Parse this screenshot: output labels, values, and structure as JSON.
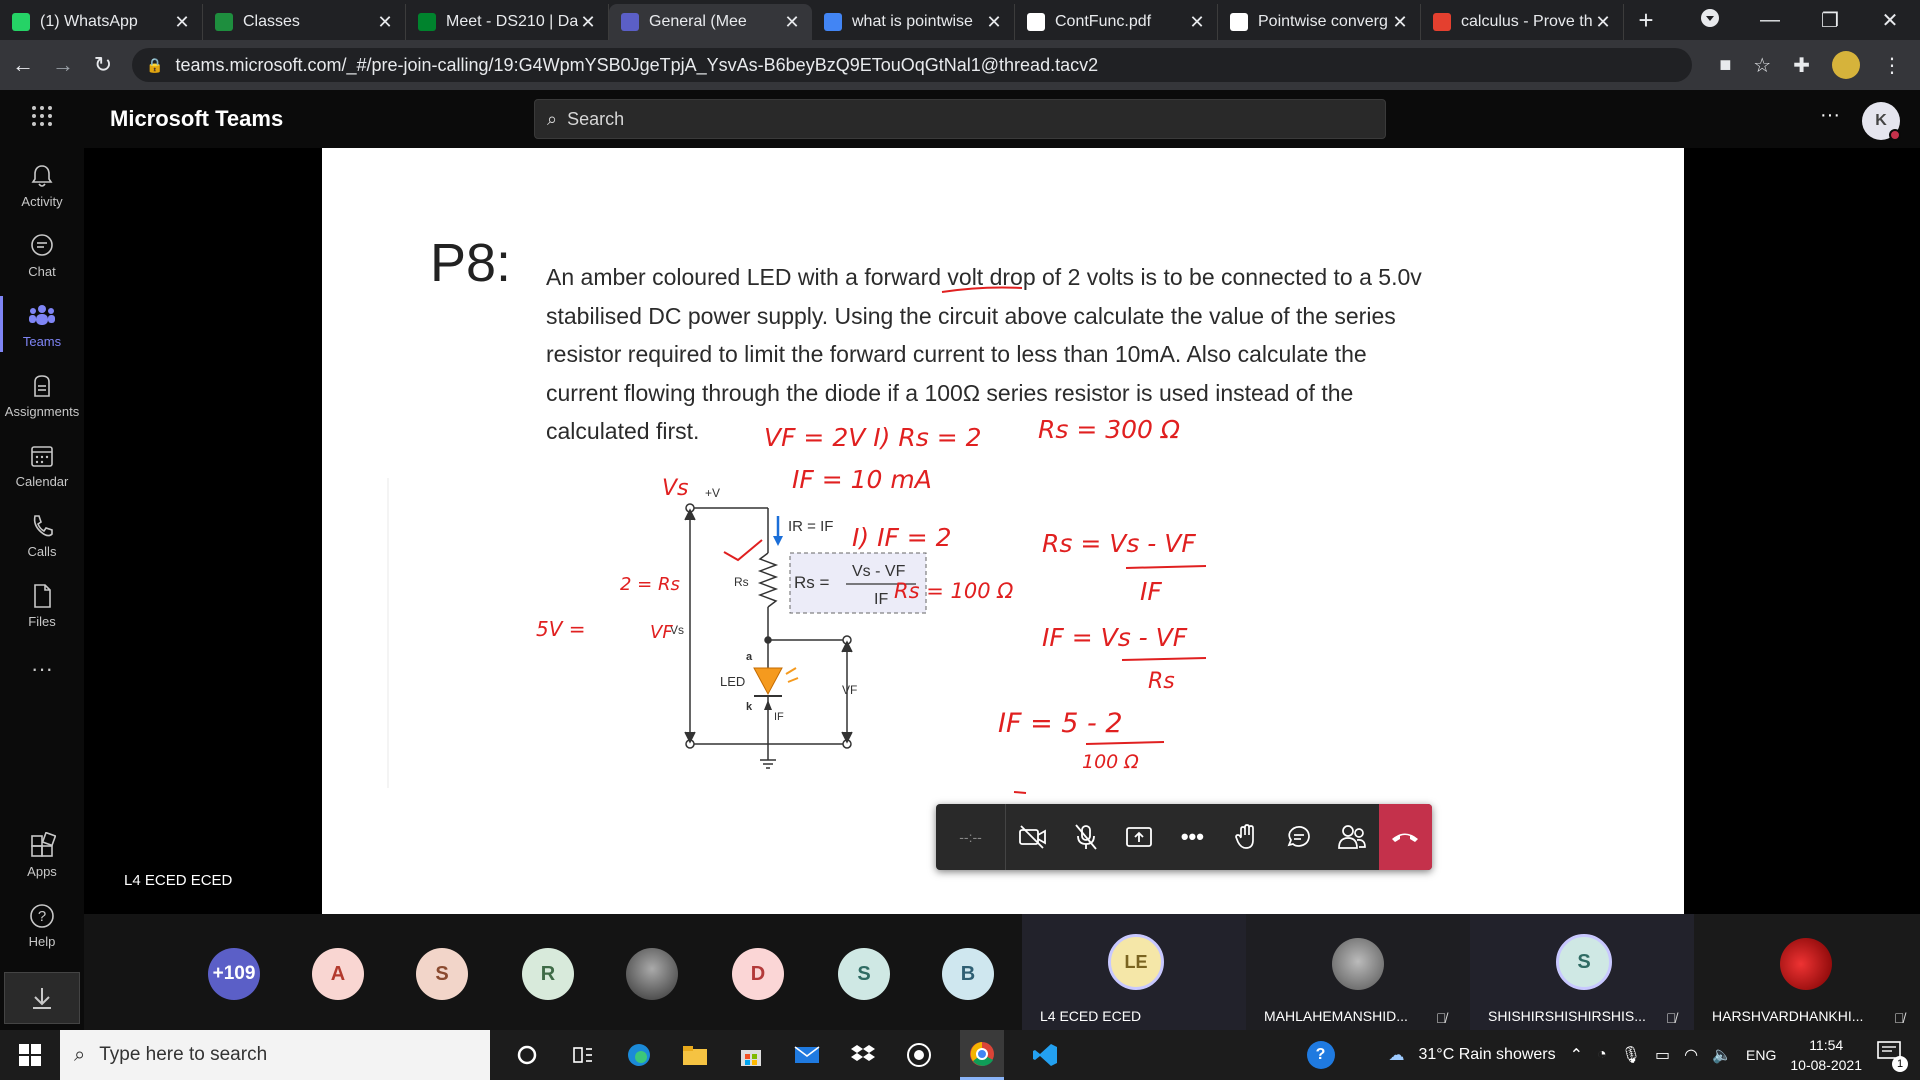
{
  "browser": {
    "tabs": [
      {
        "label": "(1) WhatsApp",
        "color": "#25d366"
      },
      {
        "label": "Classes",
        "color": "#1e8e3e"
      },
      {
        "label": "Meet - DS210 | Da",
        "color": "#00832d"
      },
      {
        "label": "General (Mee",
        "color": "#5b5fc7"
      },
      {
        "label": "what is pointwise",
        "color": "#4285f4"
      },
      {
        "label": "ContFunc.pdf",
        "color": "#ffffff"
      },
      {
        "label": "Pointwise converg",
        "color": "#ffffff"
      },
      {
        "label": "calculus - Prove th",
        "color": "#e4402f"
      }
    ],
    "url": "teams.microsoft.com/_#/pre-join-calling/19:G4WpmYSB0JgeTpjA_YsvAs-B6beyBzQ9ETouOqGtNal1@thread.tacv2"
  },
  "teams": {
    "app_title": "Microsoft Teams",
    "search_placeholder": "Search",
    "user_initial": "K",
    "rail": [
      {
        "label": "Activity",
        "icon": "bell-icon"
      },
      {
        "label": "Chat",
        "icon": "chat-icon"
      },
      {
        "label": "Teams",
        "icon": "teams-icon"
      },
      {
        "label": "Assignments",
        "icon": "assignments-icon"
      },
      {
        "label": "Calendar",
        "icon": "calendar-icon"
      },
      {
        "label": "Calls",
        "icon": "phone-icon"
      },
      {
        "label": "Files",
        "icon": "file-icon"
      },
      {
        "label": "Apps",
        "icon": "apps-icon"
      },
      {
        "label": "Help",
        "icon": "help-icon"
      }
    ]
  },
  "slide": {
    "number": "P8:",
    "problem_lines": [
      "An amber coloured LED with a forward volt drop of 2 volts is to be connected to a 5.0v",
      "stabilised DC power supply. Using the circuit above calculate the value of the series",
      "resistor required to limit the forward current to less than 10mA. Also calculate the",
      "current flowing through the diode if a 100Ω series resistor is used instead of the",
      "calculated first."
    ],
    "circuit": {
      "supply": "+V",
      "current_label": "IR = IF",
      "formula_num": "Vs - VF",
      "formula_den": "IF",
      "formula_lhs": "Rs =",
      "rs_label": "Rs",
      "vs_label": "Vs",
      "led_label": "LED",
      "anode": "a",
      "cathode": "k",
      "if_label": "IF",
      "vf_label": "VF"
    },
    "handwriting": {
      "h1": "VF = 2V  I) Rs = 2",
      "h2": "Rs = 300 Ω",
      "h3": "IF = 10 mA",
      "h4": "Vs",
      "h5": "I) IF = 2",
      "h6": "Rs = 100 Ω",
      "h7": "Rs = Vs - VF",
      "h8": "IF",
      "h9": "IF = Vs - VF",
      "h10": "Rs",
      "h11": "IF = 5 - 2",
      "h12": "100 Ω",
      "h13": "2 = Rs",
      "h14": "5V =",
      "h15": "VF"
    }
  },
  "stage": {
    "presenter_name": "L4 ECED ECED",
    "timer": "--:--"
  },
  "participants": {
    "overflow": "+109",
    "avatars": [
      {
        "initial": "A",
        "bg": "#f9d6d2",
        "fg": "#b33a2e"
      },
      {
        "initial": "S",
        "bg": "#f2d5c9",
        "fg": "#8a4a2f"
      },
      {
        "initial": "R",
        "bg": "#d8eadb",
        "fg": "#3f6b47"
      },
      {
        "initial": "",
        "bg": "#666666",
        "fg": "#ffffff"
      },
      {
        "initial": "D",
        "bg": "#fbd6d6",
        "fg": "#b33a3a"
      },
      {
        "initial": "S",
        "bg": "#cfe8e4",
        "fg": "#2f6b63"
      },
      {
        "initial": "B",
        "bg": "#cfe7ef",
        "fg": "#2f5f73"
      }
    ],
    "tiles": [
      {
        "name": "L4 ECED ECED",
        "initial": "LE"
      },
      {
        "name": "MAHLAHEMANSHID...",
        "initial": ""
      },
      {
        "name": "SHISHIRSHISHIRSHIS...",
        "initial": "S"
      },
      {
        "name": "HARSHVARDHANKHI...",
        "initial": ""
      }
    ]
  },
  "taskbar": {
    "search_placeholder": "Type here to search",
    "weather": "31°C  Rain showers",
    "lang": "ENG",
    "time": "11:54",
    "date": "10-08-2021",
    "notif_count": "1"
  }
}
